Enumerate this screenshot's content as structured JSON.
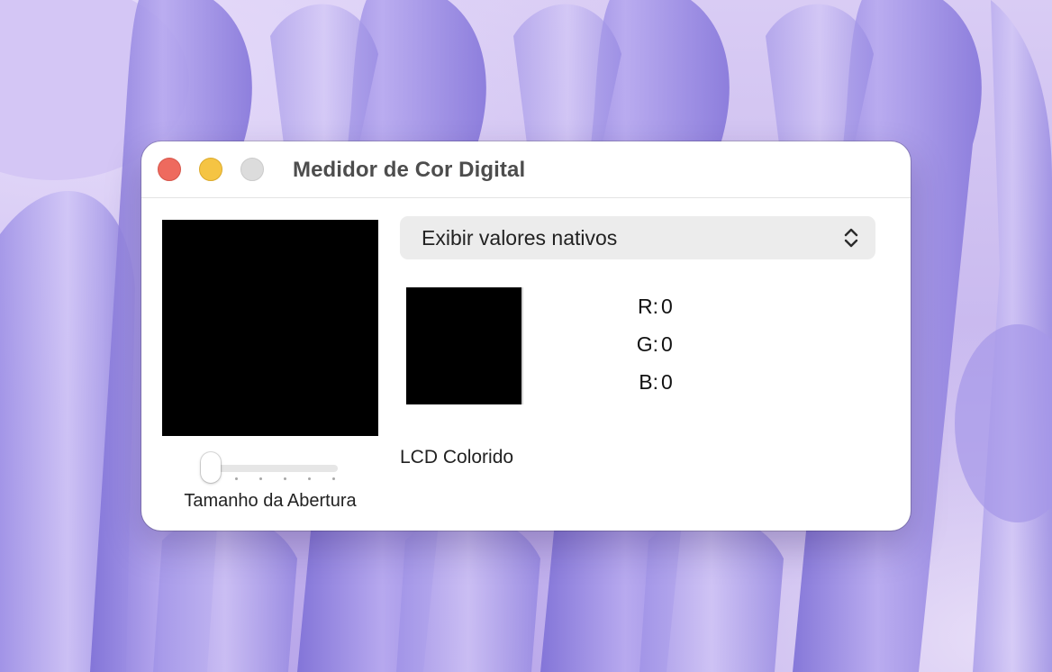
{
  "window": {
    "title": "Medidor de Cor Digital"
  },
  "colors": {
    "close": "#ee6a5e",
    "minimize": "#f5c443",
    "zoom_disabled": "#dcdcdc",
    "sample": "#000000"
  },
  "popup": {
    "selected": "Exibir valores nativos",
    "icon": "chevron-up-down-icon"
  },
  "sample": {
    "display_profile": "LCD Colorido"
  },
  "readout": [
    {
      "key": "R:",
      "value": "0"
    },
    {
      "key": "G:",
      "value": "0"
    },
    {
      "key": "B:",
      "value": "0"
    }
  ],
  "aperture": {
    "label": "Tamanho da Abertura",
    "level": 0,
    "min": 0,
    "max": 5
  }
}
